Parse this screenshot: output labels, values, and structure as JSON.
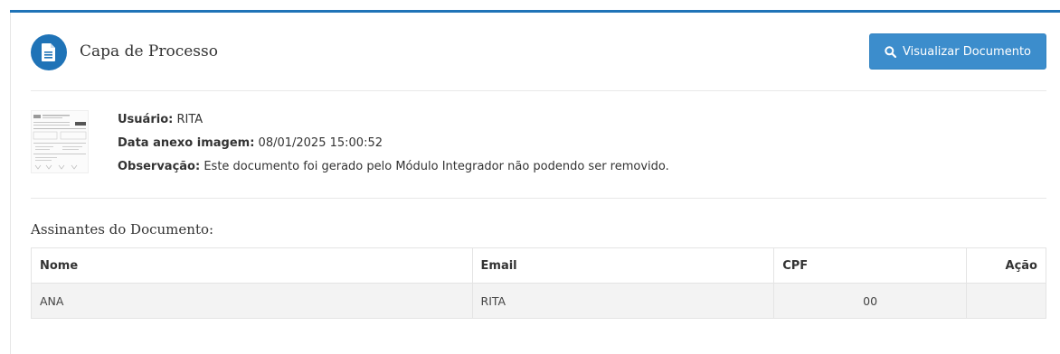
{
  "header": {
    "title": "Capa de Processo",
    "view_button_label": "Visualizar Documento",
    "icon": "document-icon",
    "accent_color": "#1f73b7"
  },
  "info": {
    "user_label": "Usuário:",
    "user_value": "RITA",
    "date_label": "Data anexo imagem:",
    "date_value": "08/01/2025 15:00:52",
    "note_label": "Observação:",
    "note_value": "Este documento foi gerado pelo Módulo Integrador não podendo ser removido."
  },
  "signers": {
    "title": "Assinantes do Documento:",
    "columns": [
      "Nome",
      "Email",
      "CPF",
      "Ação"
    ],
    "rows": [
      {
        "nome": "ANA",
        "email": "RITA",
        "cpf": "00",
        "acao": ""
      }
    ]
  }
}
